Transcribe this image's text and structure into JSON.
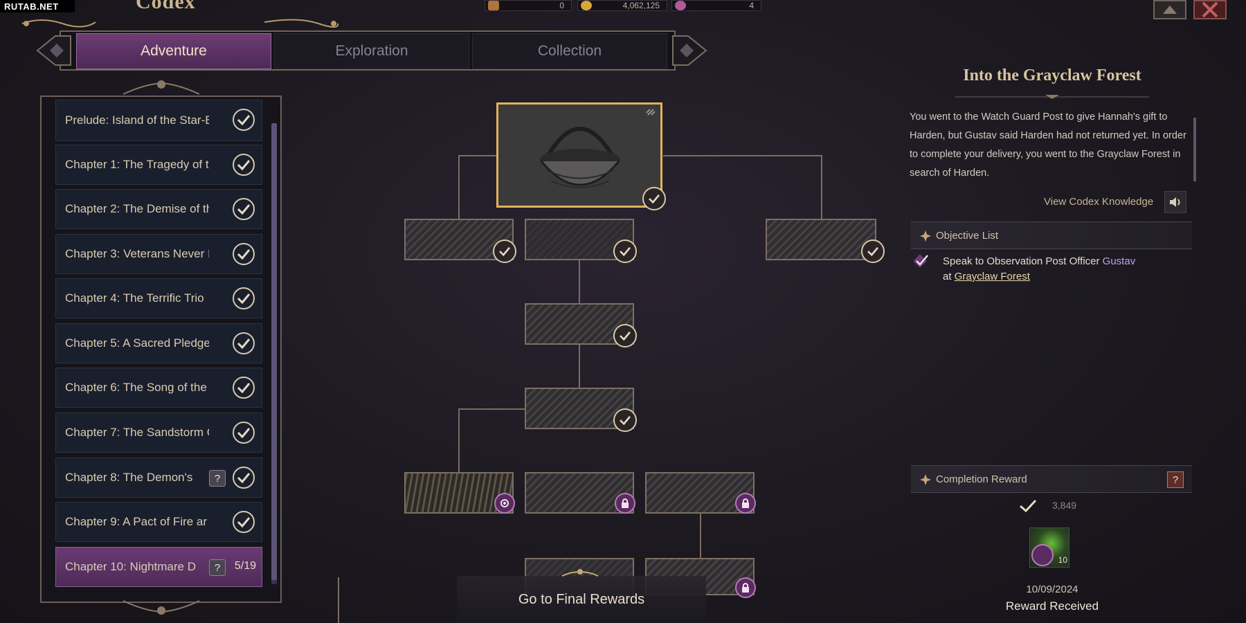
{
  "watermark": "RUTAB.NET",
  "window": {
    "title": "Codex"
  },
  "currencies": [
    {
      "name": "pen-icon",
      "value": "0"
    },
    {
      "name": "coin-icon",
      "value": "4,062,125"
    },
    {
      "name": "gem-icon",
      "value": "4"
    }
  ],
  "tabs": [
    {
      "label": "Adventure",
      "active": true
    },
    {
      "label": "Exploration",
      "active": false
    },
    {
      "label": "Collection",
      "active": false
    }
  ],
  "chapters": [
    {
      "label": "Prelude: Island of the Star-B",
      "status": "complete"
    },
    {
      "label": "Chapter 1: The Tragedy of t",
      "status": "complete"
    },
    {
      "label": "Chapter 2: The Demise of th",
      "status": "complete"
    },
    {
      "label": "Chapter 3: Veterans Never I",
      "status": "complete"
    },
    {
      "label": "Chapter 4: The Terrific Trio",
      "status": "complete"
    },
    {
      "label": "Chapter 5: A Sacred Pledge",
      "status": "complete"
    },
    {
      "label": "Chapter 6: The Song of the",
      "status": "complete"
    },
    {
      "label": "Chapter 7: The Sandstorm C",
      "status": "complete"
    },
    {
      "label": "Chapter 8: The Demon's",
      "status": "complete",
      "help": "?"
    },
    {
      "label": "Chapter 9: A Pact of Fire ar",
      "status": "complete"
    },
    {
      "label": "Chapter 10: Nightmare D",
      "status": "active",
      "help": "?",
      "progress": "5/19"
    }
  ],
  "tree": {
    "final_rewards_label": "Go to Final Rewards"
  },
  "quest": {
    "title": "Into the Grayclaw Forest",
    "description": "You went to the Watch Guard Post to give Hannah's gift to Harden, but Gustav said Harden had not returned yet. In order to complete your delivery, you went to the Grayclaw Forest in search of Harden.",
    "view_codex_label": "View Codex Knowledge",
    "objective_header": "Objective List",
    "objective": {
      "prefix": "Speak to Observation Post Officer ",
      "npc": "Gustav",
      "at": "at ",
      "location": "Grayclaw Forest"
    },
    "reward_header": "Completion Reward",
    "reward_help": "?",
    "reward_exp": "3,849",
    "reward_item_count": "10",
    "reward_date": "10/09/2024",
    "reward_status": "Reward Received"
  },
  "colors": {
    "accent": "#6d3c73",
    "gold": "#e2b35a",
    "npc": "#b8a5f0"
  }
}
